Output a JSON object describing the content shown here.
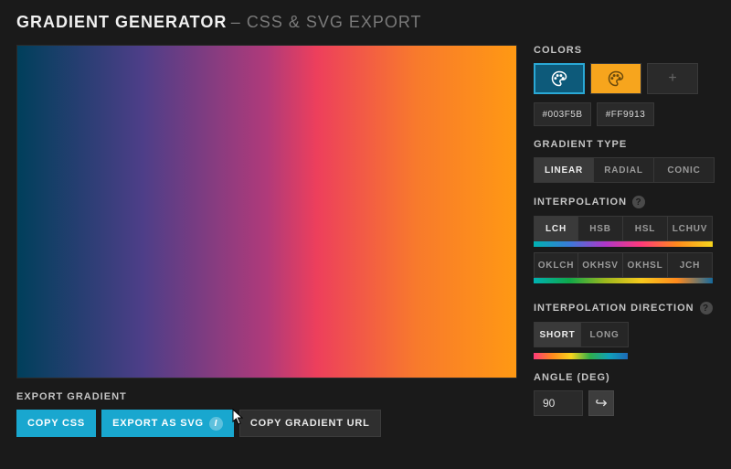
{
  "title": {
    "main": "GRADIENT GENERATOR",
    "separator": " – ",
    "sub": "CSS & SVG EXPORT"
  },
  "export": {
    "label": "EXPORT GRADIENT",
    "copy_css": "COPY CSS",
    "export_svg": "EXPORT AS SVG",
    "copy_url": "COPY GRADIENT URL"
  },
  "colors": {
    "label": "COLORS",
    "swatches": [
      {
        "hex": "#003F5B",
        "active": true
      },
      {
        "hex": "#FF9913",
        "active": false
      }
    ],
    "add_glyph": "+"
  },
  "gradient_type": {
    "label": "GRADIENT TYPE",
    "options": [
      "LINEAR",
      "RADIAL",
      "CONIC"
    ],
    "active": "LINEAR"
  },
  "interpolation": {
    "label": "INTERPOLATION",
    "rows": [
      [
        "LCH",
        "HSB",
        "HSL",
        "LCHUV"
      ],
      [
        "OKLCH",
        "OKHSV",
        "OKHSL",
        "JCH"
      ]
    ],
    "active": "LCH"
  },
  "interpolation_direction": {
    "label": "INTERPOLATION DIRECTION",
    "options": [
      "SHORT",
      "LONG"
    ],
    "active": "SHORT"
  },
  "angle": {
    "label": "ANGLE (DEG)",
    "value": "90"
  },
  "icons": {
    "help": "?",
    "info": "i",
    "reverse": "↪"
  }
}
